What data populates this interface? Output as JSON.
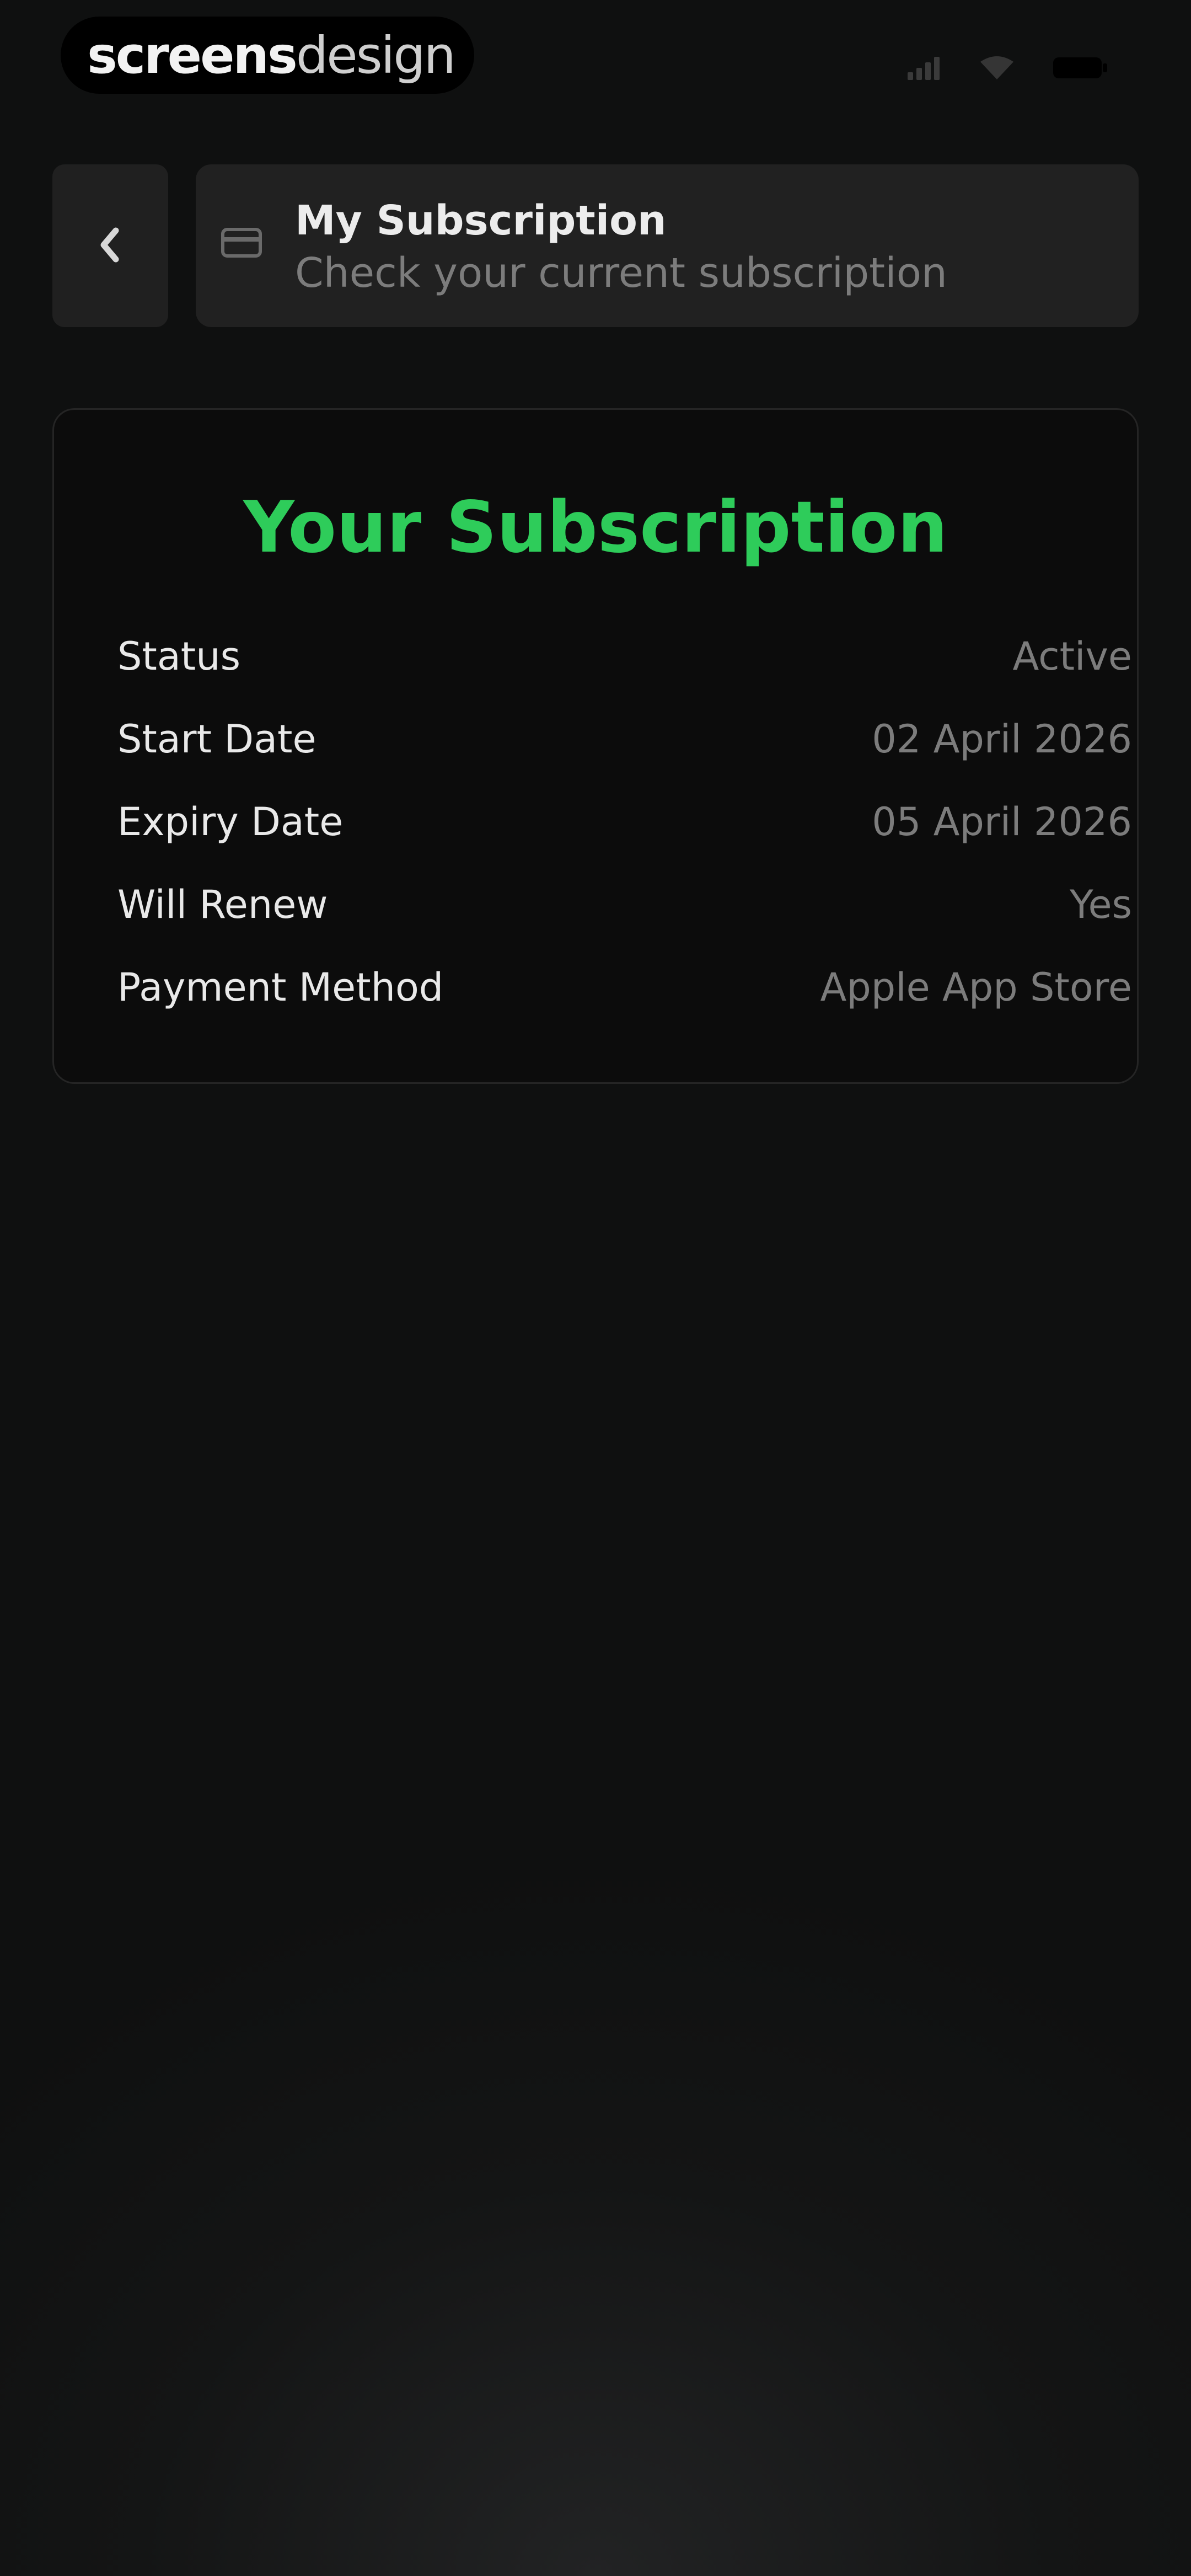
{
  "brand": {
    "part_a": "screens",
    "part_b": "design"
  },
  "status_bar": {
    "icons": [
      "signal-icon",
      "wifi-icon",
      "battery-icon"
    ]
  },
  "header": {
    "back_icon": "chevron-left-icon",
    "card_icon": "credit-card-icon",
    "title": "My Subscription",
    "subtitle": "Check your current subscription"
  },
  "subscription": {
    "heading": "Your Subscription",
    "rows": [
      {
        "label": "Status",
        "value": "Active"
      },
      {
        "label": "Start Date",
        "value": "02 April 2026"
      },
      {
        "label": "Expiry Date",
        "value": "05 April 2026"
      },
      {
        "label": "Will Renew",
        "value": "Yes"
      },
      {
        "label": "Payment Method",
        "value": "Apple App Store"
      }
    ]
  },
  "colors": {
    "accent_green": "#2ecc5a",
    "background": "#0f0f0f",
    "card": "#212121"
  }
}
